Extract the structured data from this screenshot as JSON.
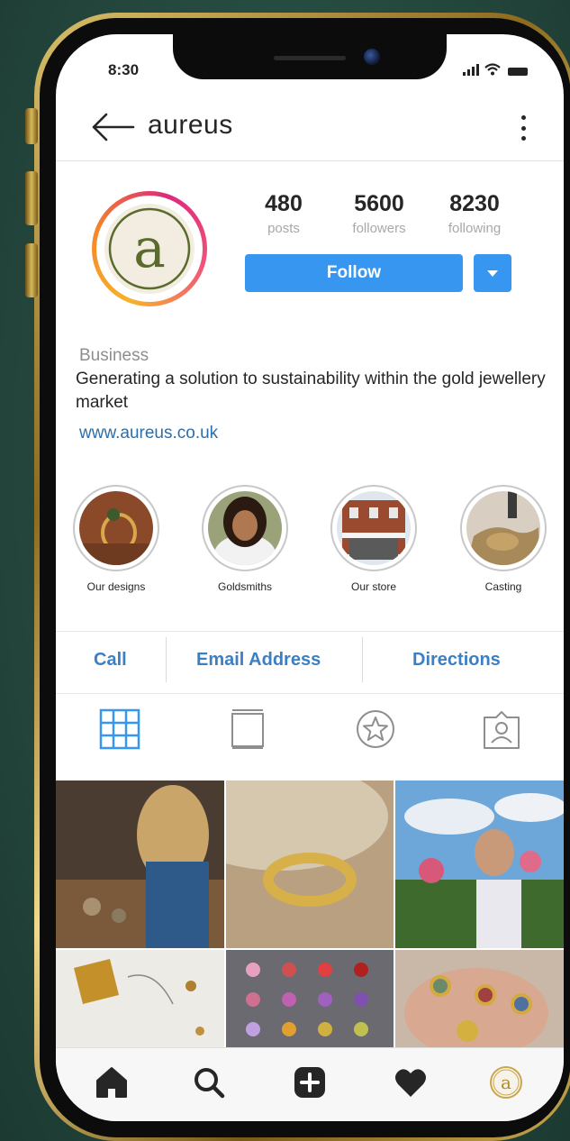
{
  "status": {
    "time": "8:30"
  },
  "header": {
    "username": "aureus",
    "back_icon": "back-arrow-icon",
    "menu_icon": "kebab-menu-icon"
  },
  "profile": {
    "avatar_letter": "a",
    "stats": [
      {
        "value": "480",
        "label": "posts"
      },
      {
        "value": "5600",
        "label": "followers"
      },
      {
        "value": "8230",
        "label": "following"
      }
    ],
    "follow_label": "Follow",
    "category": "Business",
    "bio": "Generating a solution to sustainability within the gold jewellery market",
    "website": "www.aureus.co.uk"
  },
  "highlights": [
    {
      "label": "Our designs"
    },
    {
      "label": "Goldsmiths"
    },
    {
      "label": "Our store"
    },
    {
      "label": "Casting"
    }
  ],
  "contact": {
    "call": "Call",
    "email": "Email Address",
    "directions": "Directions"
  },
  "tabs": [
    "grid-icon",
    "reels-icon",
    "star-icon",
    "tagged-icon"
  ],
  "bottom_nav": [
    "home-icon",
    "search-icon",
    "add-icon",
    "heart-icon",
    "profile-icon"
  ],
  "colors": {
    "accent": "#3797f0",
    "link": "#2f6ea6",
    "contact": "#3b7fc4",
    "gold": "#c9a74d"
  }
}
